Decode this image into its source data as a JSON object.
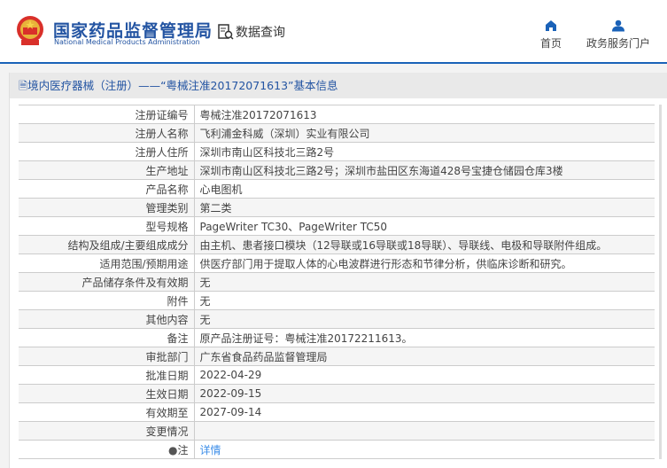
{
  "header": {
    "logo_cn": "国家药品监督管理局",
    "logo_en": "National Medical Products Administration",
    "data_query": "数据查询",
    "nav": [
      {
        "label": "首页",
        "icon": "home-icon"
      },
      {
        "label": "政务服务门户",
        "icon": "user-icon"
      }
    ]
  },
  "title": "境内医疗器械（注册）——“粤械注准20172071613”基本信息",
  "rows": [
    {
      "label": "注册证编号",
      "value": "粤械注准20172071613"
    },
    {
      "label": "注册人名称",
      "value": "飞利浦金科威（深圳）实业有限公司"
    },
    {
      "label": "注册人住所",
      "value": "深圳市南山区科技北三路2号"
    },
    {
      "label": "生产地址",
      "value": "深圳市南山区科技北三路2号；深圳市盐田区东海道428号宝捷仓储园仓库3楼"
    },
    {
      "label": "产品名称",
      "value": "心电图机"
    },
    {
      "label": "管理类别",
      "value": "第二类"
    },
    {
      "label": "型号规格",
      "value": "PageWriter TC30、PageWriter TC50"
    },
    {
      "label": "结构及组成/主要组成成分",
      "value": "由主机、患者接口模块（12导联或16导联或18导联）、导联线、电极和导联附件组成。"
    },
    {
      "label": "适用范围/预期用途",
      "value": "供医疗部门用于提取人体的心电波群进行形态和节律分析，供临床诊断和研究。"
    },
    {
      "label": "产品储存条件及有效期",
      "value": "无"
    },
    {
      "label": "附件",
      "value": "无"
    },
    {
      "label": "其他内容",
      "value": "无"
    },
    {
      "label": "备注",
      "value": "原产品注册证号：粤械注准20172211613。"
    },
    {
      "label": "审批部门",
      "value": "广东省食品药品监督管理局"
    },
    {
      "label": "批准日期",
      "value": "2022-04-29"
    },
    {
      "label": "生效日期",
      "value": "2022-09-15"
    },
    {
      "label": "有效期至",
      "value": "2027-09-14"
    },
    {
      "label": "变更情况",
      "value": ""
    }
  ],
  "note": {
    "label": "注",
    "link": "详情"
  }
}
